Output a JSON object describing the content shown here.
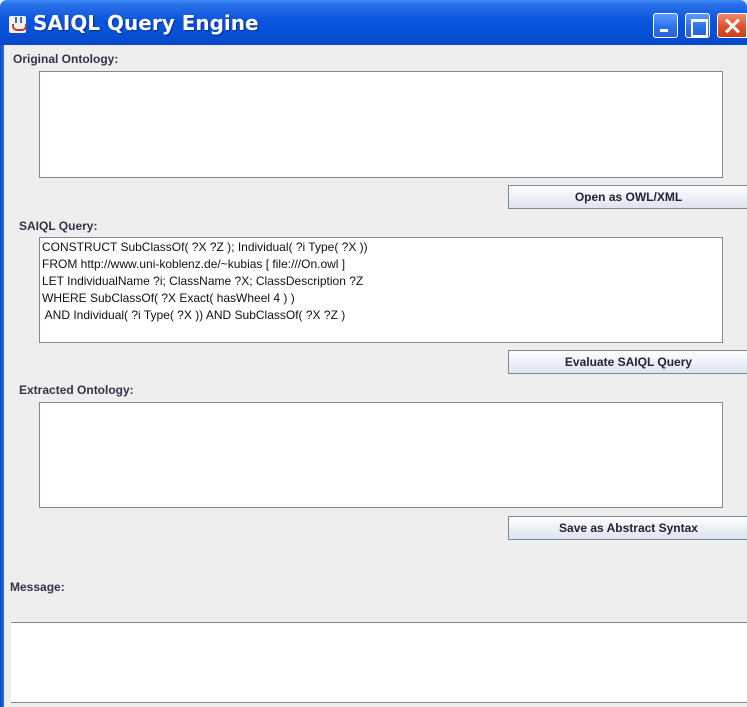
{
  "window": {
    "title": "SAIQL Query Engine",
    "controls": {
      "minimize": "minimize-icon",
      "maximize": "maximize-icon",
      "close": "close-icon"
    }
  },
  "original_ontology": {
    "label": "Original Ontology:",
    "content": "",
    "button_label": "Open as OWL/XML"
  },
  "saiql_query": {
    "label": "SAIQL Query:",
    "lines": [
      "CONSTRUCT SubClassOf( ?X ?Z ); Individual( ?i Type( ?X ))",
      "FROM http://www.uni-koblenz.de/~kubias [ file:///On.owl ]",
      "LET IndividualName ?i; ClassName ?X; ClassDescription ?Z",
      "WHERE SubClassOf( ?X Exact( hasWheel 4 ) )",
      " AND Individual( ?i Type( ?X )) AND SubClassOf( ?X ?Z )"
    ],
    "button_label": "Evaluate SAIQL Query"
  },
  "extracted_ontology": {
    "label": "Extracted Ontology:",
    "content": "",
    "button_label": "Save as Abstract Syntax"
  },
  "message": {
    "label": "Message:",
    "content": ""
  },
  "colors": {
    "titlebar": "#0a55de",
    "window_bg": "#eeeeee",
    "field_border": "#7a8a99",
    "close_button": "#e0532f"
  }
}
